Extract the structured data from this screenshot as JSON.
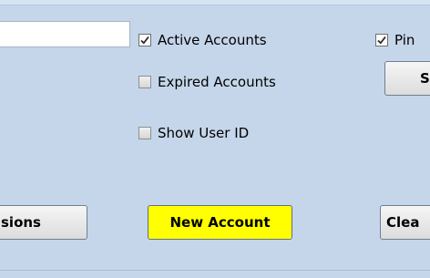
{
  "filters": {
    "active_accounts": {
      "label": "Active Accounts",
      "checked": true
    },
    "expired_accounts": {
      "label": "Expired Accounts",
      "checked": false
    },
    "show_user_id": {
      "label": "Show User ID",
      "checked": false
    },
    "pin": {
      "label": "Pin",
      "checked": true
    }
  },
  "buttons": {
    "permissions": "sions",
    "new_account": "New Account",
    "clear": "Clea",
    "right_partial": "S"
  },
  "colors": {
    "background": "#c5d6ea",
    "new_account_button": "#ffff00"
  }
}
